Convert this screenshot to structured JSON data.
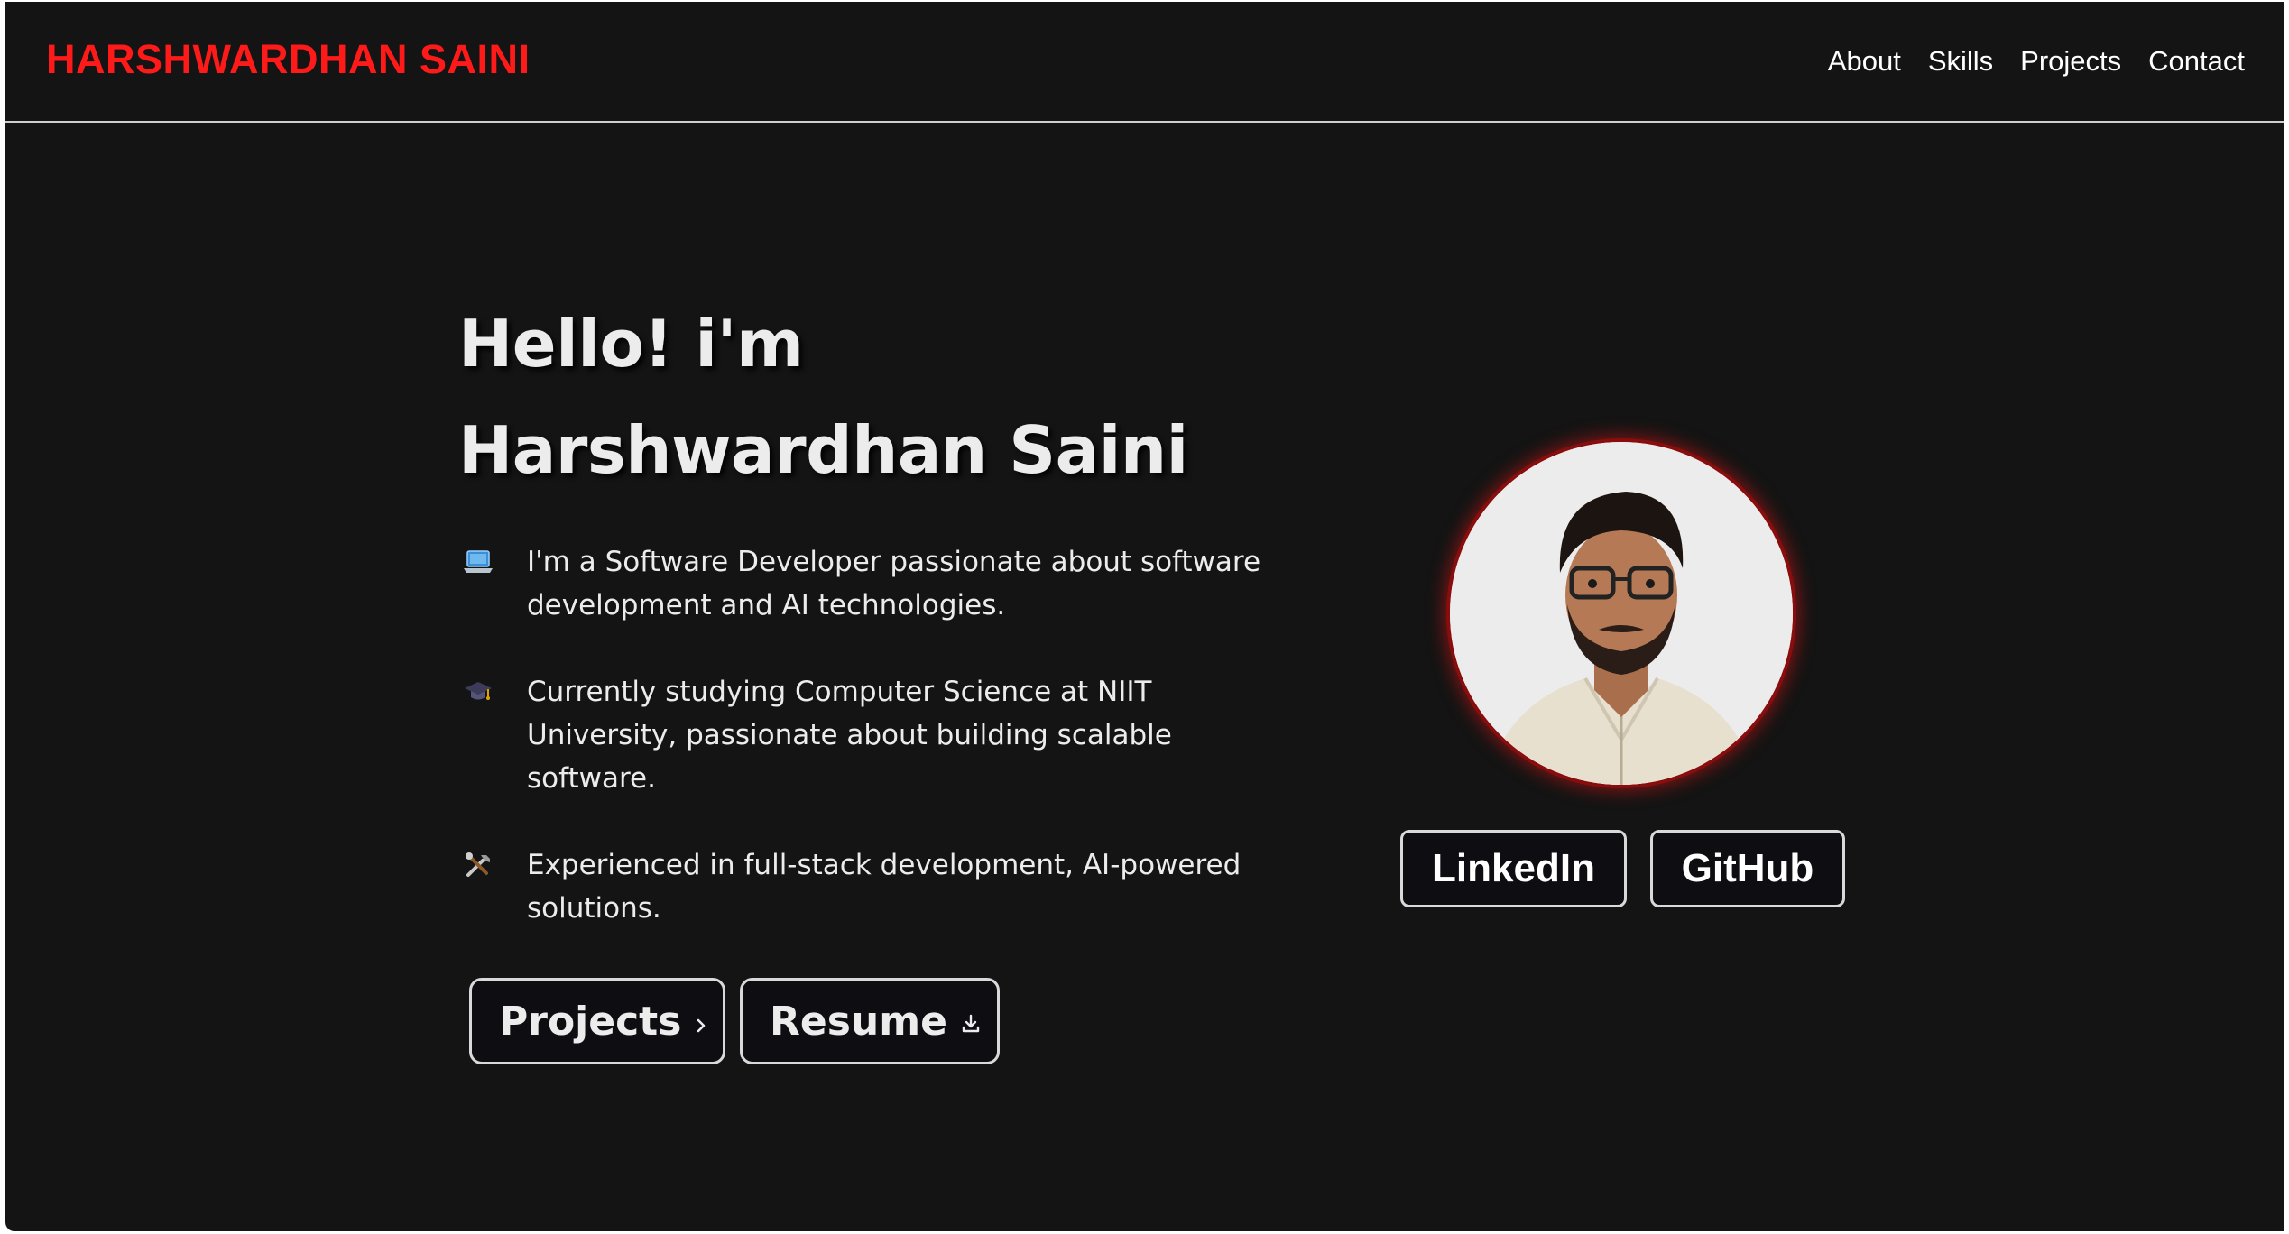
{
  "brand": {
    "name": "HARSHWARDHAN SAINI",
    "color": "#ff1a1a"
  },
  "nav": {
    "items": [
      {
        "label": "About"
      },
      {
        "label": "Skills"
      },
      {
        "label": "Projects"
      },
      {
        "label": "Contact"
      }
    ]
  },
  "hero": {
    "greeting": "Hello! i'm",
    "name": "Harshwardhan Saini",
    "points": [
      {
        "icon": "laptop-icon",
        "text": "I'm a Software Developer passionate about software development and AI technologies."
      },
      {
        "icon": "graduation-cap-icon",
        "text": "Currently studying Computer Science at NIIT University, passionate about building scalable software."
      },
      {
        "icon": "tools-icon",
        "text": "Experienced in full-stack development, AI-powered solutions."
      }
    ],
    "buttons": {
      "projects_label": "Projects",
      "projects_icon": "chevron-right-icon",
      "resume_label": "Resume",
      "resume_icon": "download-icon"
    }
  },
  "profile": {
    "avatar_icon": "profile-photo",
    "ring_color": "#8a0d0d",
    "social": {
      "linkedin_label": "LinkedIn",
      "github_label": "GitHub"
    }
  },
  "theme": {
    "background": "#141414",
    "text": "#ececec"
  }
}
